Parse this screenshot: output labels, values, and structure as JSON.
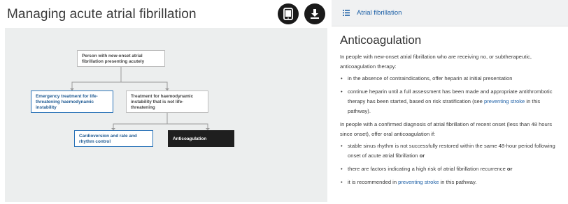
{
  "left_panel": {
    "title": "Managing acute atrial fibrillation",
    "buttons": {
      "device_icon": "tablet-icon",
      "download_icon": "download-icon"
    },
    "flowchart": {
      "nodes": {
        "root": "Person with new-onset atrial fibrillation presenting acutely",
        "emergency": "Emergency treatment for life-threatening haemodynamic instability",
        "treatment": "Treatment for haemodynamic instability that is not life-threatening",
        "cardioversion": "Cardioversion and rate and rhythm control",
        "anticoagulation": "Anticoagulation"
      }
    }
  },
  "right_panel": {
    "tab_icon": "list-icon",
    "tab_label": "Atrial fibrillation",
    "section_title": "Anticoagulation",
    "intro": "In people with new-onset atrial fibrillation who are receiving no, or subtherapeutic, anticoagulation therapy:",
    "bullets_1": [
      {
        "text": "in the absence of contraindications, offer heparin at initial presentation"
      },
      {
        "text": "continue heparin until a full assessment has been made and appropriate antithrombotic therapy has been started, based on risk stratification (see ",
        "link": "preventing stroke",
        "after": " in this pathway)."
      }
    ],
    "para2": "In people with a confirmed diagnosis of atrial fibrillation of recent onset (less than 48 hours since onset), offer oral anticoagulation if:",
    "bullets_2": [
      {
        "text": "stable sinus rhythm is not successfully restored within the same 48-hour period following onset of acute atrial fibrillation ",
        "bold": "or"
      },
      {
        "text": "there are factors indicating a high risk of atrial fibrillation recurrence ",
        "bold": "or"
      },
      {
        "text": "it is recommended in ",
        "link": "preventing stroke",
        "after": " in this pathway."
      }
    ],
    "colors": {
      "link": "#1c5fa6",
      "tab_bg": "#f0f1f2"
    }
  }
}
